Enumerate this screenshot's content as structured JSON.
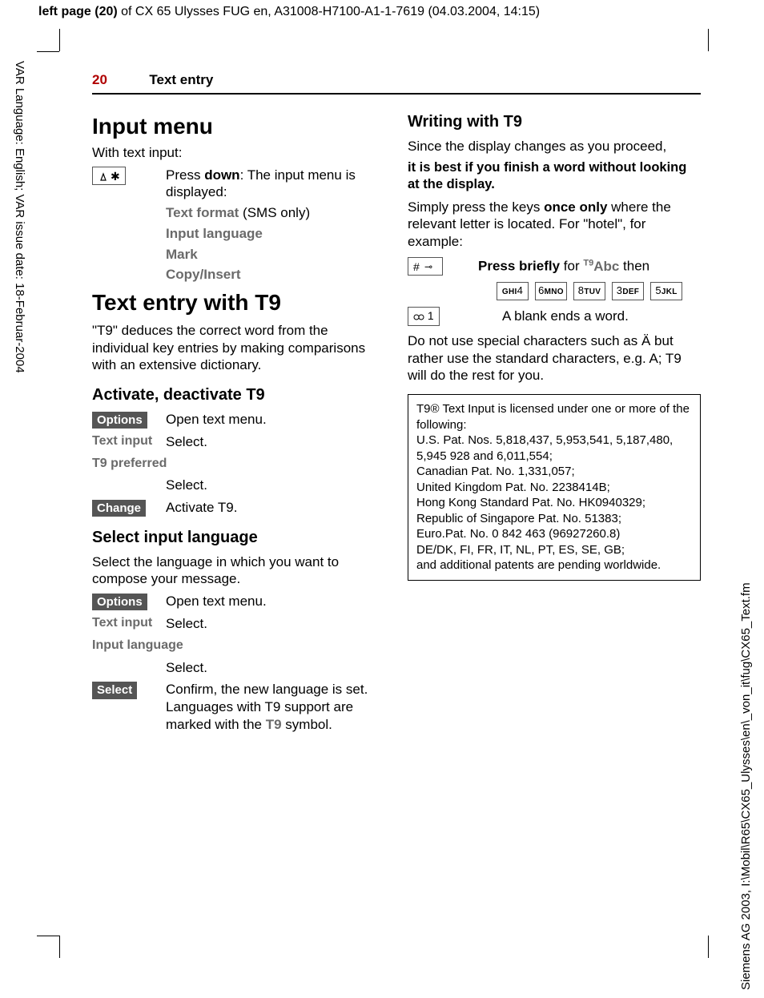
{
  "header": {
    "bold": "left page (20)",
    "rest": " of CX 65 Ulysses FUG en, A31008-H7100-A1-1-7619 (04.03.2004, 14:15)"
  },
  "leftMargin": "VAR Language: English; VAR issue date: 18-Februar-2004",
  "rightMargin": "Siemens AG 2003, I:\\Mobil\\R65\\CX65_Ulysses\\en\\_von_it\\fug\\CX65_Text.fm",
  "runningHead": {
    "pageNum": "20",
    "title": "Text entry"
  },
  "left": {
    "h1a": "Input menu",
    "intro": "With text input:",
    "pressDown1": "Press ",
    "pressDownBold": "down",
    "pressDown2": ": The input menu is displayed:",
    "menu1a": "Text format",
    "menu1b": " (SMS only)",
    "menu2": "Input language",
    "menu3": "Mark",
    "menu4": "Copy/Insert",
    "h1b": "Text entry with T9",
    "t9desc": "\"T9\" deduces the correct word from the individual key entries by making comparisons with an extensive dictionary.",
    "h2a": "Activate, deactivate T9",
    "optionsBtn": "Options",
    "openTextMenu": "Open text menu.",
    "textInput": "Text input",
    "select": "Select.",
    "t9pref": "T9 preferred",
    "changeBtn": "Change",
    "activateT9": "Activate T9.",
    "h2b": "Select input language",
    "selLangDesc": "Select the language in which you want to compose your message.",
    "inputLang": "Input language",
    "selectBtn": "Select",
    "confirmLang": "Confirm, the new language is set. Languages with T9 support are marked with the ",
    "t9sym": "T9",
    "confirmLang2": " symbol."
  },
  "right": {
    "h2a": "Writing with T9",
    "since": "Since the display changes as you proceed,",
    "bestBold": "it is best if you finish a word without looking at the display.",
    "simply1": "Simply press the keys ",
    "simplyBold": "once only",
    "simply2": " where the relevant letter is located. For \"hotel\", for example:",
    "pressBriefly": "Press briefly",
    "forText": " for ",
    "t9abc": "T9Abc",
    "thenText": " then",
    "key4": "GHI 4",
    "key6": "6 MNO",
    "key8": "8 TUV",
    "key3": "3 DEF",
    "key5": "5 JKL",
    "key1": "1",
    "blankEnds": "A blank ends a word.",
    "specialChars": "Do not use special characters such as Ä but rather use the standard characters, e.g. A; T9 will do the rest for you.",
    "box1": "T9® Text Input is licensed under one or more of the following:",
    "box2": "U.S. Pat. Nos. 5,818,437, 5,953,541, 5,187,480, 5,945 928 and 6,011,554;",
    "box3": "Canadian Pat. No. 1,331,057;",
    "box4": "United Kingdom Pat. No. 2238414B;",
    "box5": "Hong Kong Standard Pat. No. HK0940329;",
    "box6": "Republic of Singapore Pat. No. 51383;",
    "box7": "Euro.Pat. No. 0 842 463 (96927260.8)",
    "box8": "DE/DK, FI, FR, IT, NL, PT, ES, SE, GB;",
    "box9": "and additional patents are pending worldwide."
  }
}
